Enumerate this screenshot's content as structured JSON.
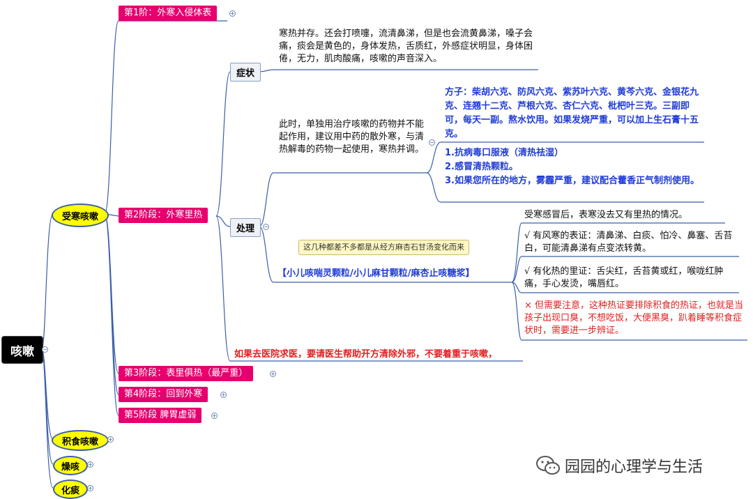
{
  "root": {
    "label": "咳嗽"
  },
  "categories": [
    {
      "label": "受寒咳嗽"
    },
    {
      "label": "积食咳嗽"
    },
    {
      "label": "燥咳"
    },
    {
      "label": "化痰"
    }
  ],
  "stages": [
    {
      "label": "第1阶：外寒入侵体表"
    },
    {
      "label": "第2阶段：外寒里热"
    },
    {
      "label": "第3阶段：表里俱热（最严重）"
    },
    {
      "label": "第4阶段：回到外寒"
    },
    {
      "label": "第5阶段 脾胃虚弱"
    }
  ],
  "stage2": {
    "symptoms_label": "症状",
    "symptoms_text": "寒热并存。还会打喷嚏，流清鼻涕，但是也会流黄鼻涕，嗓子会痛，痰会是黄色的，身体发热，舌质红，外感症状明显，身体困倦，无力，肌肉酸痛，咳嗽的声音深入。",
    "treatment_label": "处理",
    "treatment_text": "此时，单独用治疗咳嗽的药物并不能起作用，建议用中药的散外寒，与清热解毒的药物一起使用，寒热并调。",
    "prescription": "方子：柴胡六克、防风六克、紫苏叶六克、黄芩六克、金银花九克、连翘十二克、芦根六克、杏仁六克、枇杷叶三克。三副即可，每天一副。熬水饮用。如果发烧严重，可以加上生石膏十五克。",
    "medicines": [
      "1.抗病毒口服液（清热祛湿）",
      "2.感冒清热颗粒。",
      "3.如果您所在的地方，雾霾严重，建议配合藿香正气制剂使用。"
    ],
    "tooltip": "这几种都差不多都是从经方麻杏石甘汤变化而来",
    "granules": "【小儿咳喘灵颗粒/小儿麻甘颗粒/麻杏止咳糖浆】",
    "granule_notes": [
      "受寒感冒后，表寒没去又有里热的情况。",
      "√ 有风寒的表证：清鼻涕、白痰、怕冷、鼻塞、舌苔白，可能清鼻涕有点变浓转黄。",
      "√ 有化热的里证：舌尖红，舌苔黄或红，喉咙红肿痛，手心发烫，嘴唇红。"
    ],
    "warning": "× 但需要注意，这种热证要排除积食的热证，也就是当孩子出现口臭，不想吃饭，大便黑臭，趴着睡等积食症状时，需要进一步辨证。",
    "hospital_note": "如果去医院求医，要请医生帮助开方清除外邪，不要着重于咳嗽，"
  },
  "watermark": {
    "text": "园园的心理学与生活",
    "icon": "wechat-icon"
  },
  "colors": {
    "stage": "#e6006e",
    "category": "#ffff00",
    "line": "#3a5fa8",
    "prescription": "#1f3bd6",
    "warning": "#e02020"
  }
}
